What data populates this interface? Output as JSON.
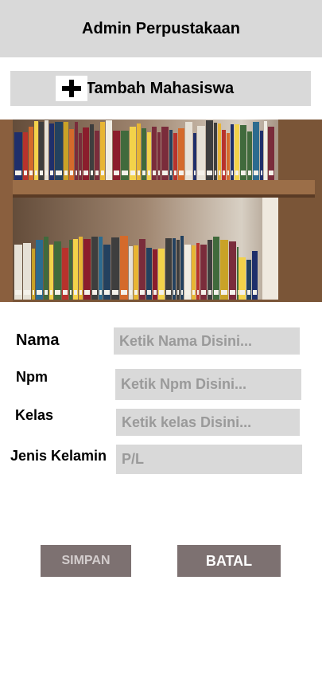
{
  "header": {
    "title": "Admin Perpustakaan"
  },
  "add_bar": {
    "label": "Tambah Mahasiswa",
    "icon": "plus-icon"
  },
  "banner": {
    "image": "library-bookshelf-photo"
  },
  "form": {
    "nama": {
      "label": "Nama",
      "placeholder": "Ketik Nama Disini..."
    },
    "npm": {
      "label": "Npm",
      "placeholder": "Ketik Npm Disini..."
    },
    "kelas": {
      "label": "Kelas",
      "placeholder": "Ketik kelas Disini..."
    },
    "jenis_kelamin": {
      "label": "Jenis Kelamin",
      "placeholder": "P/L"
    }
  },
  "actions": {
    "save_label": "SIMPAN",
    "cancel_label": "BATAL"
  },
  "colors": {
    "header_bg": "#d9d9d9",
    "input_bg": "#d9d9d9",
    "button_bg": "#7d7171",
    "save_text": "#d3cdcd",
    "cancel_text": "#ffffff"
  }
}
